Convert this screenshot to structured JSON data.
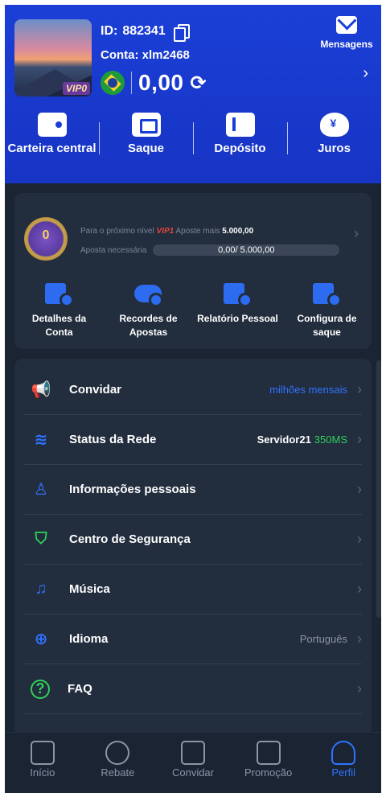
{
  "profile": {
    "id_label": "ID:",
    "id": "882341",
    "conta_label": "Conta:",
    "conta": "xlm2468",
    "vip_badge": "VIP0",
    "balance": "0,00",
    "refresh_icon": "⟳"
  },
  "header": {
    "messages_label": "Mensagens",
    "chevron": "›"
  },
  "quick_actions": [
    {
      "label": "Carteira central",
      "icon": "wallet-icon"
    },
    {
      "label": "Saque",
      "icon": "withdraw-icon"
    },
    {
      "label": "Depósito",
      "icon": "deposit-icon"
    },
    {
      "label": "Juros",
      "icon": "piggy-bank-icon"
    }
  ],
  "vip": {
    "level": "0",
    "next_prefix": "Para o próximo nível",
    "next_vip": "VIP1",
    "bet_more": "Aposte mais",
    "bet_more_value": "5.000,00",
    "required_label": "Aposta necessária",
    "progress_text": "0,00/ 5.000,00",
    "progress_fraction": 0,
    "chevron": "›"
  },
  "vip_actions": [
    {
      "line1": "Detalhes da",
      "line2": "Conta"
    },
    {
      "line1": "Recordes de",
      "line2": "Apostas"
    },
    {
      "line1": "Relatório Pessoal",
      "line2": ""
    },
    {
      "line1": "Configura de",
      "line2": "saque"
    }
  ],
  "menu": [
    {
      "label": "Convidar",
      "value": "milhões mensais",
      "icon": "megaphone-icon"
    },
    {
      "label": "Status da Rede",
      "value": "Servidor21",
      "ms": "350MS",
      "icon": "wifi-icon"
    },
    {
      "label": "Informações pessoais",
      "value": "",
      "icon": "user-edit-icon"
    },
    {
      "label": "Centro de Segurança",
      "value": "",
      "icon": "shield-icon"
    },
    {
      "label": "Música",
      "value": "",
      "icon": "music-icon"
    },
    {
      "label": "Idioma",
      "value": "Português",
      "icon": "globe-icon"
    },
    {
      "label": "FAQ",
      "value": "",
      "icon": "question-icon"
    }
  ],
  "menu_chevron": "›",
  "tabs": [
    {
      "label": "Início"
    },
    {
      "label": "Rebate"
    },
    {
      "label": "Convidar"
    },
    {
      "label": "Promoção"
    },
    {
      "label": "Perfil"
    }
  ],
  "colors": {
    "header_blue": "#1b3fd6",
    "accent_blue": "#2e73ff",
    "ms_green": "#2fd25b",
    "vip_red": "#e0463d"
  }
}
